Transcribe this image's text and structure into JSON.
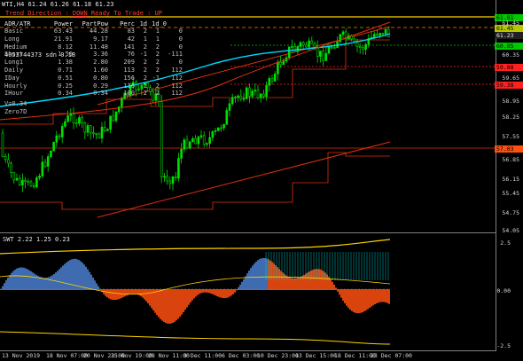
{
  "header": {
    "symbol_line": "WTI,H4  61.24 61.26 61.18 61.23",
    "trend_label": "Trend Direction : ",
    "trend_value": "DOWN",
    "ready_label": "  Ready To Trade : ",
    "ready_value": "UP"
  },
  "info_table": {
    "columns": [
      "ADR/ATR",
      "Power",
      "PartPow",
      "Perc",
      "1d",
      "1d_0"
    ],
    "rows": [
      [
        "Basic",
        "63.43",
        "44.28",
        "83",
        "2",
        "1",
        "0"
      ],
      [
        "Long",
        "21.91",
        "9.17",
        "42",
        "1",
        "1",
        "0"
      ],
      [
        "Medium",
        "8.12",
        "11.48",
        "141",
        "2",
        "2",
        "0"
      ],
      [
        "Short",
        "1.50",
        "3.36",
        "76",
        "-1",
        "2",
        "-111"
      ],
      [
        "Long1",
        "1.38",
        "2.80",
        "209",
        "2",
        "2",
        "0"
      ],
      [
        "Daily",
        "0.71",
        "1.60",
        "113",
        "2",
        "2",
        "112"
      ],
      [
        "IDay",
        "0.51",
        "0.80",
        "156",
        "2",
        "-1",
        "112"
      ],
      [
        "Hourly",
        "0.25",
        "0.29",
        "116",
        "2",
        "2",
        "112"
      ],
      [
        "IHour",
        "0.34",
        "0.34",
        "100",
        "2",
        "2",
        "112"
      ]
    ],
    "overlay_text": "4053744373  sdn 0.18",
    "v_line": "V=0.34",
    "zero_line": "Zero7D"
  },
  "price_tags": [
    {
      "value": "61.81",
      "color": "#00c800"
    },
    {
      "value": "61.45",
      "color": "#b8c800"
    },
    {
      "value": "61.23",
      "color": "#202020"
    },
    {
      "value": "60.85",
      "color": "#00c800"
    },
    {
      "value": "59.88",
      "color": "#ff2020"
    },
    {
      "value": "59.38",
      "color": "#ff2020"
    },
    {
      "value": "57.03",
      "color": "#ff5010"
    }
  ],
  "main_y_axis": {
    "ticks": [
      "61.45",
      "60.35",
      "59.65",
      "58.95",
      "58.25",
      "57.55",
      "56.85",
      "56.15",
      "55.45",
      "54.75",
      "54.05"
    ]
  },
  "sub_panel": {
    "title": "SWT 2.22 1.25 0.23",
    "y_ticks": [
      "2.5",
      "0.00",
      "-2.5"
    ]
  },
  "x_axis": {
    "labels": [
      "13 Nov 2019",
      "18 Nov 07:00",
      "20 Nov 23:00",
      "25 Nov 19:00",
      "28 Nov 11:00",
      "3 Dec 11:00",
      "6 Dec 03:00",
      "10 Dec 23:00",
      "13 Dec 15:00",
      "18 Dec 11:00",
      "23 Dec 07:00"
    ]
  },
  "colors": {
    "candle": "#00e000",
    "ma_cyan": "#00d8ff",
    "trend_red": "#e03010",
    "dotted_green": "#00c800",
    "dotted_red": "#ff2020",
    "yellow_line": "#ffd400",
    "sub_fill_red": "#ff5010",
    "sub_fill_blue": "#4a7fd0",
    "sub_fill_cyan": "#00c8c8"
  }
}
